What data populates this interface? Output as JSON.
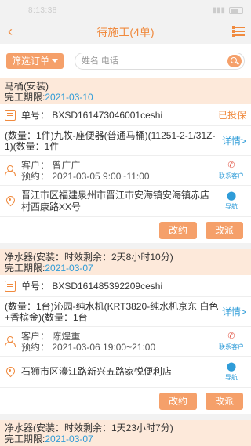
{
  "status_bar": {
    "time": "8:13:38"
  },
  "nav": {
    "title": "待施工(4单)"
  },
  "filter": {
    "button_label": "筛选订单",
    "search_placeholder": "姓名|电话"
  },
  "orders": [
    {
      "type_line": "马桶(安装)",
      "deadline_label": "完工期限:",
      "deadline_value": "2021-03-10",
      "order_no": "单号：  BXSD161473046001ceshi",
      "order_flag": "已投保",
      "goods": "(数量：1件)九牧-座便器(普通马桶)(11251-2-1/31Z-1)(数量：1件",
      "goods_more": "详情>",
      "customer": "客户：  曾广广",
      "appointment": "预约：  2021-03-05 9:00~11:00",
      "contact_label": "联系客户",
      "address": "晋江市区福建泉州市晋江市安海镇安海镇赤店村西康路XX号",
      "nav_label": "导航",
      "btn_reschedule": "改约",
      "btn_reassign": "改派"
    },
    {
      "type_line": "净水器(安装：时效剩余：2天8小时10分)",
      "deadline_label": "完工期限:",
      "deadline_value": "2021-03-07",
      "order_no": "单号：  BXSD161485392209ceshi",
      "order_flag": "",
      "goods": "(数量：1台)沁园-纯水机(KRT3820-纯水机京东 白色+香槟金)(数量：1台",
      "goods_more": "详情>",
      "customer": "客户：  陈煌重",
      "appointment": "预约：  2021-03-06 19:00~21:00",
      "contact_label": "联系客户",
      "address": "石狮市区濠江路新兴五路家悦便利店",
      "nav_label": "导航",
      "btn_reschedule": "改约",
      "btn_reassign": "改派"
    },
    {
      "type_line": "净水器(安装：时效剩余：1天23小时7分)",
      "deadline_label": "完工期限:",
      "deadline_value": "2021-03-07"
    }
  ]
}
